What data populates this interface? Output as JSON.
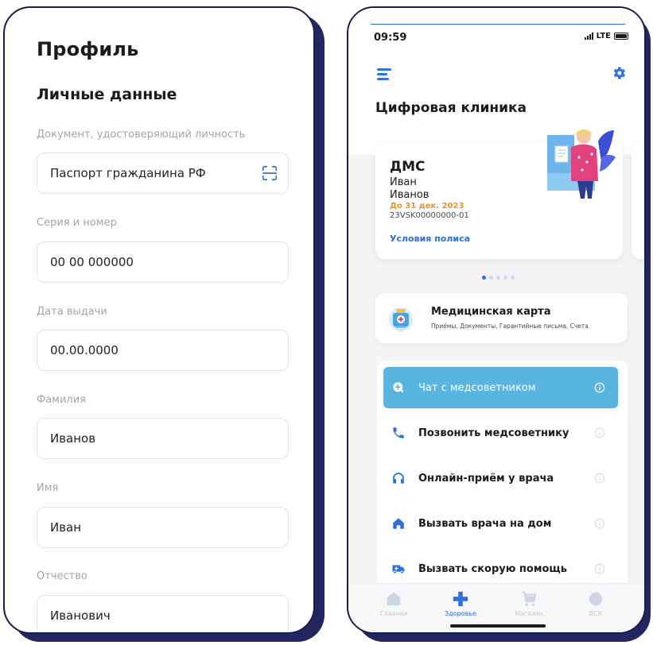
{
  "profile": {
    "title": "Профиль",
    "section": "Личные данные",
    "fields": [
      {
        "label": "Документ, удостоверяющий личность",
        "value": "Паспорт гражданина РФ"
      },
      {
        "label": "Серия и номер",
        "value": "00 00 000000"
      },
      {
        "label": "Дата выдачи",
        "value": "00.00.0000"
      },
      {
        "label": "Фамилия",
        "value": "Иванов"
      },
      {
        "label": "Имя",
        "value": "Иван"
      },
      {
        "label": "Отчество",
        "value": "Иванович"
      }
    ]
  },
  "status_bar": {
    "time": "09:59",
    "network": "LTE"
  },
  "clinic": {
    "title": "Цифровая клиника",
    "policy_card": {
      "title": "ДМС",
      "first_name": "Иван",
      "last_name": "Иванов",
      "valid_until": "До 31 дек. 2023",
      "number": "23VSK00000000-01",
      "link": "Условия полиса"
    },
    "medcard": {
      "title": "Медицинская карта",
      "subtitle": "Приёмы, Документы, Гарантийные письма, Счета"
    },
    "actions": [
      {
        "label": "Чат с медсоветником",
        "icon": "chat-icon",
        "active": true
      },
      {
        "label": "Позвонить медсоветнику",
        "icon": "phone-icon"
      },
      {
        "label": "Онлайн-приём у врача",
        "icon": "headphones-icon"
      },
      {
        "label": "Вызвать врача на дом",
        "icon": "house-icon"
      },
      {
        "label": "Вызвать скорую помощь",
        "icon": "ambulance-icon"
      }
    ]
  },
  "tabbar": [
    {
      "label": "Главная",
      "icon": "home-icon"
    },
    {
      "label": "Здоровье",
      "icon": "cross-icon",
      "active": true
    },
    {
      "label": "Магазин",
      "icon": "cart-icon"
    },
    {
      "label": "ВСК",
      "icon": "circle-icon"
    }
  ],
  "colors": {
    "accent": "#2f6fd8",
    "active_action": "#5ab4e0",
    "date": "#f19024",
    "frame": "#1c1d4f"
  }
}
